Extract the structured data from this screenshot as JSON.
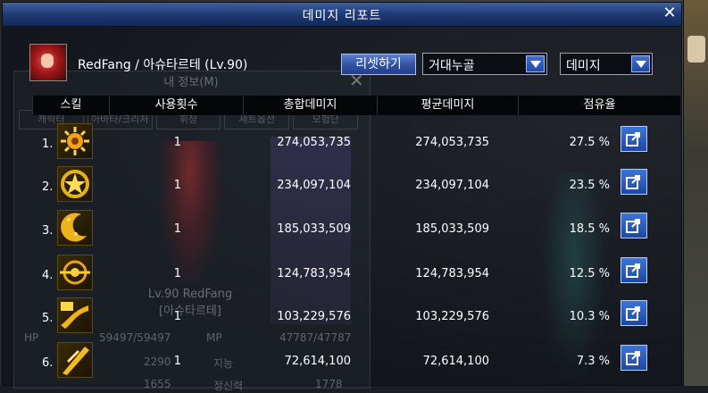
{
  "window": {
    "title": "데미지 리포트"
  },
  "player": {
    "name": "RedFang / 아슈타르테 (Lv.90)"
  },
  "controls": {
    "reset_label": "리셋하기",
    "filter_dropdown": "거대누골",
    "metric_dropdown": "데미지"
  },
  "table": {
    "headers": [
      "스킬",
      "사용횟수",
      "총합데미지",
      "평균데미지",
      "점유율"
    ],
    "rows": [
      {
        "rank": "1.",
        "uses": "1",
        "total": "274,053,735",
        "avg": "274,053,735",
        "share": "27.5 %",
        "icon": "sun-skill-icon"
      },
      {
        "rank": "2.",
        "uses": "1",
        "total": "234,097,104",
        "avg": "234,097,104",
        "share": "23.5 %",
        "icon": "star-skill-icon"
      },
      {
        "rank": "3.",
        "uses": "1",
        "total": "185,033,509",
        "avg": "185,033,509",
        "share": "18.5 %",
        "icon": "crescent-skill-icon"
      },
      {
        "rank": "4.",
        "uses": "1",
        "total": "124,783,954",
        "avg": "124,783,954",
        "share": "12.5 %",
        "icon": "orb-skill-icon"
      },
      {
        "rank": "5.",
        "uses": "1",
        "total": "103,229,576",
        "avg": "103,229,576",
        "share": "10.3 %",
        "icon": "wave-skill-icon"
      },
      {
        "rank": "6.",
        "uses": "1",
        "total": "72,614,100",
        "avg": "72,614,100",
        "share": "7.3 %",
        "icon": "slash-skill-icon"
      }
    ]
  },
  "background_panel": {
    "title": "내 정보(M)",
    "tabs": [
      "캐릭터",
      "아바타/크리처",
      "휘장",
      "세트옵션",
      "모험단"
    ],
    "character_level": "Lv.90 RedFang",
    "character_job": "[아슈타르테]",
    "hp_label": "HP",
    "hp_value": "59497/59497",
    "mp_label": "MP",
    "mp_value": "47787/47787",
    "stat_a": "2290",
    "stat_b_label": "지능",
    "stat_c": "1655",
    "stat_d_label": "정신력",
    "stat_e": "1778"
  },
  "colors": {
    "title_bar": "#1f3a73",
    "button": "#2f51a0",
    "text": "#ffffff"
  }
}
